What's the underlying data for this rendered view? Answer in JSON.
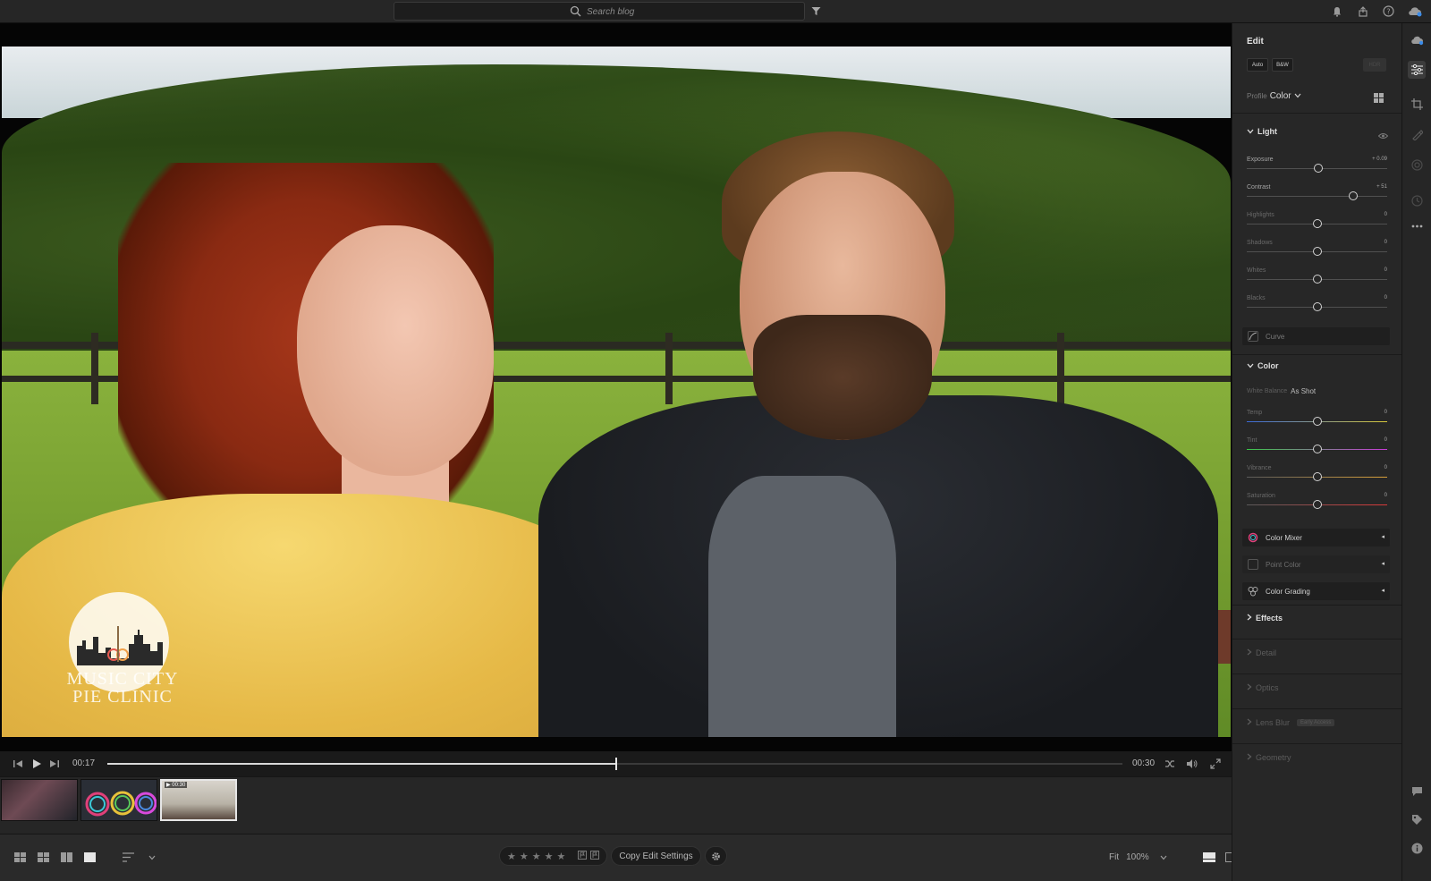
{
  "search": {
    "placeholder": "Search blog"
  },
  "playback": {
    "current_time": "00:17",
    "total_time": "00:30",
    "progress": 0.5
  },
  "filmstrip": {
    "thumbs": [
      {
        "label": ""
      },
      {
        "label": ""
      },
      {
        "label": "▶ 00:30"
      }
    ]
  },
  "photo": {
    "logo_text_line1": "MUSIC CITY",
    "logo_text_line2": "PIE CLINIC"
  },
  "bottombar": {
    "copy_settings": "Copy Edit Settings",
    "fit_label": "Fit",
    "zoom_label": "100%"
  },
  "edit_panel": {
    "title": "Edit",
    "auto_button": "Auto",
    "bw_button": "B&W",
    "hdr_button": "HDR",
    "profile_label": "Profile",
    "profile_value": "Color",
    "light": {
      "title": "Light",
      "sliders": [
        {
          "label": "Exposure",
          "value": "+ 0.09",
          "position": 0.51
        },
        {
          "label": "Contrast",
          "value": "+ 51",
          "position": 0.76
        },
        {
          "label": "Highlights",
          "value": "0",
          "position": 0.5
        },
        {
          "label": "Shadows",
          "value": "0",
          "position": 0.5
        },
        {
          "label": "Whites",
          "value": "0",
          "position": 0.5
        },
        {
          "label": "Blacks",
          "value": "0",
          "position": 0.5
        }
      ],
      "curve_label": "Curve"
    },
    "color": {
      "title": "Color",
      "white_balance_label": "White Balance",
      "white_balance_value": "As Shot",
      "sliders": [
        {
          "label": "Temp",
          "value": "0",
          "position": 0.5
        },
        {
          "label": "Tint",
          "value": "0",
          "position": 0.5
        },
        {
          "label": "Vibrance",
          "value": "0",
          "position": 0.5
        },
        {
          "label": "Saturation",
          "value": "0",
          "position": 0.5
        }
      ],
      "mixer_label": "Color Mixer",
      "point_color_label": "Point Color",
      "grading_label": "Color Grading"
    },
    "effects_label": "Effects",
    "detail_label": "Detail",
    "optics_label": "Optics",
    "lens_blur_label": "Lens Blur",
    "lens_blur_badge": "Early Access",
    "geometry_label": "Geometry"
  }
}
